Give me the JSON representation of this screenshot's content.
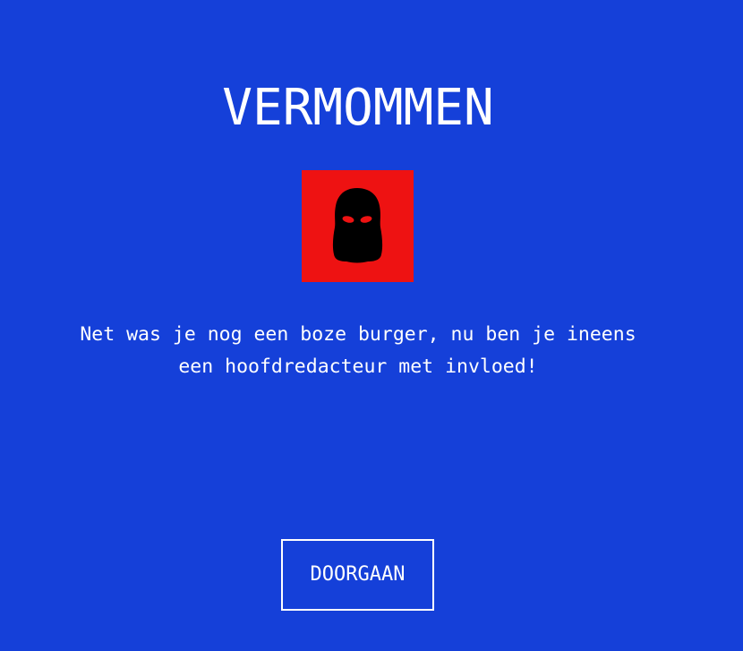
{
  "screen": {
    "title": "VERMOMMEN",
    "icon": "balaclava-icon",
    "message_lines": [
      "Net was je nog een boze burger, nu ben je ineens",
      "een hoofdredacteur met invloed!"
    ],
    "continue_label": "DOORGAAN"
  },
  "colors": {
    "background": "#1540d9",
    "icon_background": "#ee1212",
    "text": "#ffffff",
    "mask": "#000000"
  }
}
